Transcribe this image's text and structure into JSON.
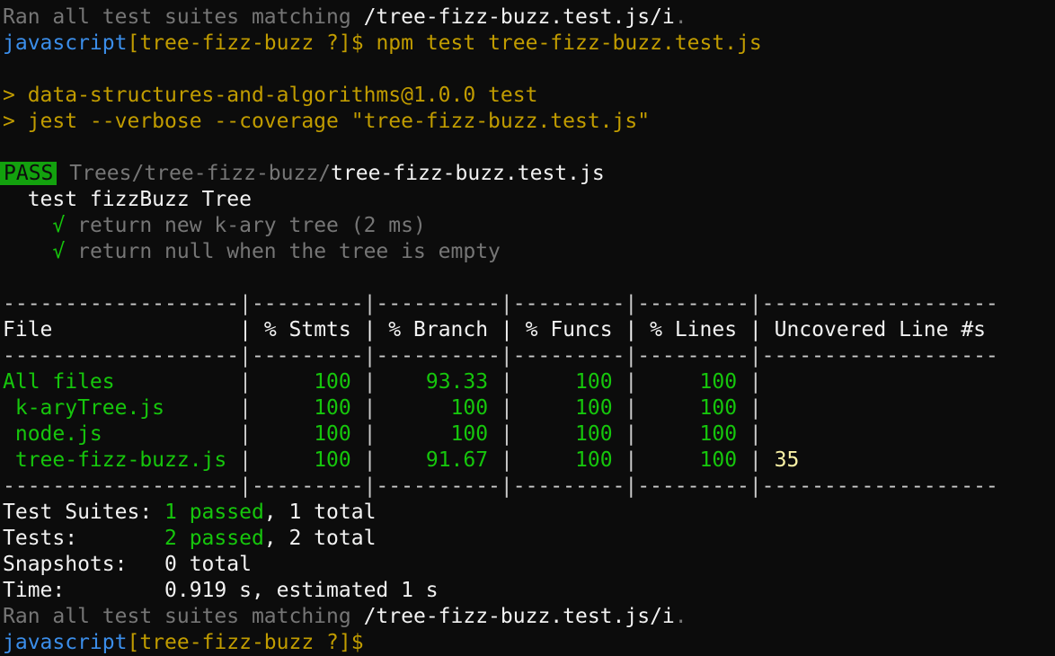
{
  "colors": {
    "background": "#0c0c0c",
    "prompt_dir": "#3b8eea",
    "prompt_branch": "#c19c00",
    "pass": "#16c60c",
    "pass_badge": "#13a10e",
    "uncovered": "#f9f1a5",
    "dim": "#767676",
    "text": "#cccccc"
  },
  "top": {
    "ran_prefix": "Ran all test suites matching ",
    "ran_pattern": "/tree-fizz-buzz.test.js/i",
    "ran_suffix": "."
  },
  "prompt1": {
    "dir": "javascript",
    "branch": "[tree-fizz-buzz ?]",
    "symbol": "$",
    "command": " npm test tree-fizz-buzz.test.js"
  },
  "npm": {
    "line1": "> data-structures-and-algorithms@1.0.0 test",
    "line2": "> jest --verbose --coverage \"tree-fizz-buzz.test.js\""
  },
  "result": {
    "badge": "PASS",
    "path_dim": "Trees/tree-fizz-buzz/",
    "file": "tree-fizz-buzz.test.js"
  },
  "suite": {
    "name": "  test fizzBuzz Tree",
    "tests": [
      {
        "check": "    √",
        "text": " return new k-ary tree (2 ms)"
      },
      {
        "check": "    √",
        "text": " return null when the tree is empty"
      }
    ]
  },
  "coverage": {
    "separator": "-------------------|---------|----------|---------|---------|-------------------",
    "header": {
      "file": "File               ",
      "stmts": " % Stmts ",
      "branch": " % Branch ",
      "funcs": " % Funcs ",
      "lines": " % Lines ",
      "uncovered": " Uncovered Line #s "
    },
    "rows": [
      {
        "file": "All files          ",
        "stmts": "     100 ",
        "branch": "    93.33 ",
        "funcs": "     100 ",
        "lines": "     100 ",
        "uncovered": ""
      },
      {
        "file": " k-aryTree.js      ",
        "stmts": "     100 ",
        "branch": "      100 ",
        "funcs": "     100 ",
        "lines": "     100 ",
        "uncovered": ""
      },
      {
        "file": " node.js           ",
        "stmts": "     100 ",
        "branch": "      100 ",
        "funcs": "     100 ",
        "lines": "     100 ",
        "uncovered": ""
      },
      {
        "file": " tree-fizz-buzz.js ",
        "stmts": "     100 ",
        "branch": "    91.67 ",
        "funcs": "     100 ",
        "lines": "     100 ",
        "uncovered": " 35"
      }
    ]
  },
  "summary": {
    "suites_label": "Test Suites: ",
    "suites_passed": "1 passed",
    "suites_total": ", 1 total",
    "tests_label": "Tests:       ",
    "tests_passed": "2 passed",
    "tests_total": ", 2 total",
    "snapshots_label": "Snapshots:   ",
    "snapshots_value": "0 total",
    "time_label": "Time:        ",
    "time_value": "0.919 s, estimated 1 s"
  },
  "bottom": {
    "ran_prefix": "Ran all test suites matching ",
    "ran_pattern": "/tree-fizz-buzz.test.js/i",
    "ran_suffix": "."
  },
  "prompt2": {
    "dir": "javascript",
    "branch": "[tree-fizz-buzz ?]",
    "symbol": "$"
  }
}
